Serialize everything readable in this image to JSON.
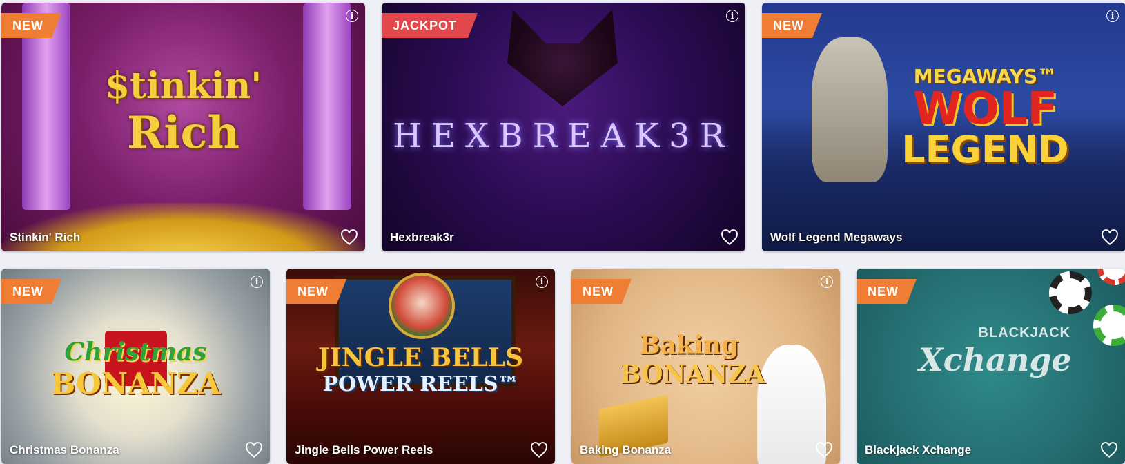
{
  "badges": {
    "new": "NEW",
    "jackpot": "JACKPOT"
  },
  "info_glyph": "i",
  "games": [
    {
      "title": "Stinkin' Rich",
      "badge": "NEW",
      "logo": [
        "$tinkin'",
        "Rich"
      ]
    },
    {
      "title": "Hexbreak3r",
      "badge": "JACKPOT",
      "logo": [
        "HEXBREAK3R"
      ]
    },
    {
      "title": "Wolf Legend Megaways",
      "badge": "NEW",
      "logo": [
        "MEGAWAYS™",
        "WOLF",
        "LEGEND"
      ]
    },
    {
      "title": "Christmas Bonanza",
      "badge": "NEW",
      "logo": [
        "Christmas",
        "BONANZA"
      ]
    },
    {
      "title": "Jingle Bells Power Reels",
      "badge": "NEW",
      "logo": [
        "JINGLE BELLS",
        "POWER REELS™"
      ]
    },
    {
      "title": "Baking Bonanza",
      "badge": "NEW",
      "logo": [
        "Baking",
        "BONANZA"
      ]
    },
    {
      "title": "Blackjack Xchange",
      "badge": "NEW",
      "logo": [
        "BLACKJACK",
        "Xchange"
      ]
    }
  ],
  "colors": {
    "new_badge": "#ef7d33",
    "jackpot_badge": "#e2474b",
    "page_bg": "#eef0f6"
  },
  "icons": {
    "favorite": "heart-outline-icon",
    "info": "info-circle-icon"
  }
}
